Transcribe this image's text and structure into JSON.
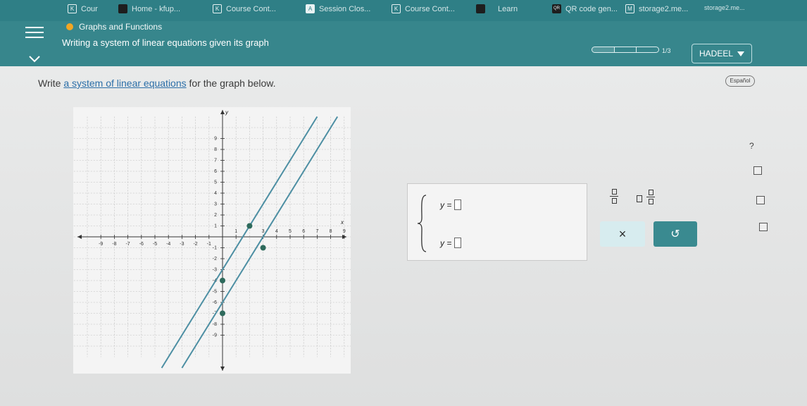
{
  "browser": {
    "tabs": [
      {
        "icon": "K",
        "title": "Cour"
      },
      {
        "icon": "",
        "title": "Home - kfup..."
      },
      {
        "icon": "K",
        "title": "Course Cont..."
      },
      {
        "icon": "A",
        "title": "Session Clos..."
      },
      {
        "icon": "K",
        "title": "Course Cont..."
      },
      {
        "icon": "",
        "title": "Learn"
      },
      {
        "icon": "QR",
        "title": "QR code gen..."
      },
      {
        "icon": "M",
        "title": "storage2.me..."
      },
      {
        "icon": "",
        "title": "storage2.me..."
      }
    ],
    "new_tab": "+"
  },
  "header": {
    "topic": "Graphs and Functions",
    "lesson": "Writing a system of linear equations given its graph",
    "progress_label": "1/3",
    "progress_fraction": 0.33,
    "user": "HADEEL"
  },
  "question": {
    "prefix": "Write ",
    "link": "a system of linear equations",
    "suffix": " for the graph below.",
    "language_button": "Español"
  },
  "graph": {
    "x_label": "x",
    "y_label": "y",
    "x_ticks": [
      "-9",
      "-8",
      "-7",
      "-6",
      "-5",
      "-4",
      "-3",
      "-2",
      "-1",
      "1",
      "3",
      "4",
      "5",
      "6",
      "7",
      "8",
      "9"
    ],
    "y_ticks": [
      "9",
      "8",
      "7",
      "6",
      "5",
      "4",
      "3",
      "2",
      "1",
      "-1",
      "-2",
      "-3",
      "-4",
      "-5",
      "-6",
      "-7",
      "-8",
      "-9"
    ],
    "lines": [
      {
        "color": "#4d8fa3",
        "points": [
          [
            2,
            1
          ],
          [
            3,
            3
          ]
        ],
        "slope": 2,
        "intercept": -3
      },
      {
        "color": "#4d8fa3",
        "points": [
          [
            0,
            -4
          ],
          [
            0,
            -7
          ]
        ],
        "slope": 2,
        "intercept": -6
      }
    ]
  },
  "answer": {
    "eq1_prefix": "y =",
    "eq2_prefix": "y ="
  },
  "tools": {
    "clear": "×",
    "undo": "↺"
  },
  "side": {
    "help": "?"
  }
}
